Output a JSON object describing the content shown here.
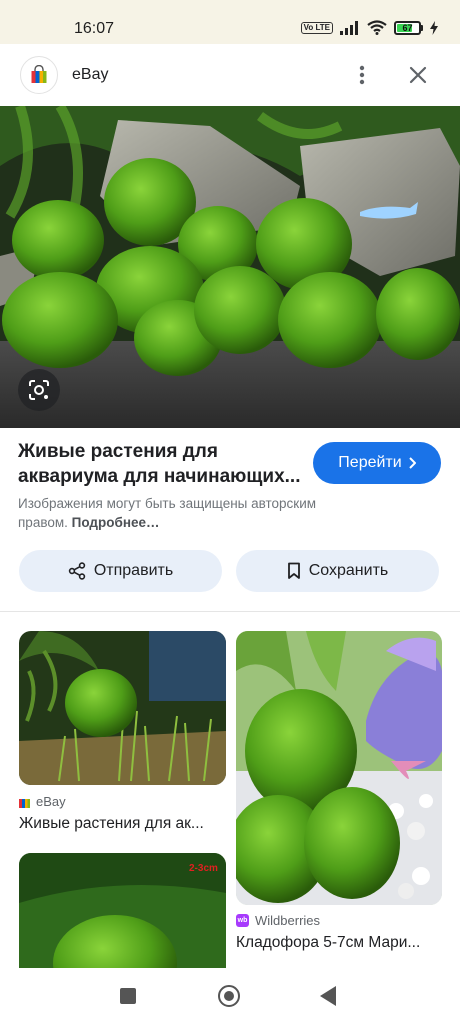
{
  "status_bar": {
    "time": "16:07",
    "volte": "Vo LTE",
    "battery": "67"
  },
  "header": {
    "site_name": "eBay",
    "logo_icon": "ebay-shopping-bag-icon",
    "more_icon": "more-vert-icon",
    "close_icon": "close-icon"
  },
  "hero": {
    "image": "marimo-moss-balls-aquarium",
    "lens_icon": "google-lens-icon"
  },
  "result": {
    "title": "Живые растения для аквариума для начинающих...",
    "goto_label": "Перейти",
    "copyright_text": "Изображения могут быть защищены авторским правом.",
    "copyright_more": "Подробнее…"
  },
  "actions": {
    "share_label": "Отправить",
    "save_label": "Сохранить"
  },
  "related": [
    {
      "source": "eBay",
      "title": "Живые растения для ак..."
    },
    {
      "source": "Wildberries",
      "title": "Кладофора 5-7см Мари..."
    },
    {
      "overlay_text": "2-3cm"
    }
  ],
  "colors": {
    "accent": "#1a73e8",
    "action_bg": "#e8eff9",
    "status_bar_bg": "#f6f3e6"
  }
}
